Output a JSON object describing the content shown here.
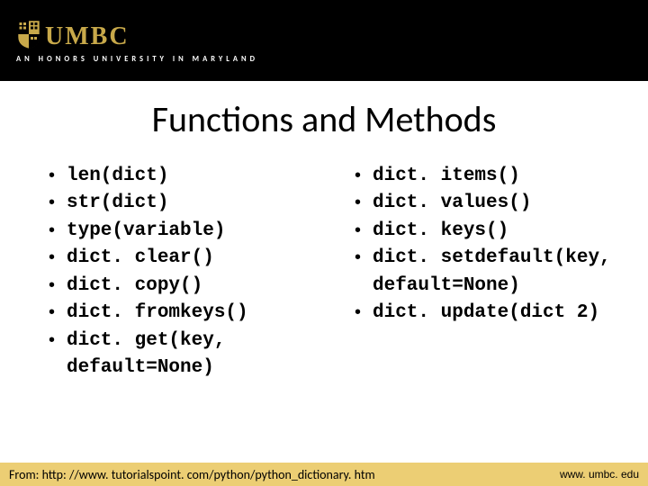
{
  "header": {
    "logo_text": "UMBC",
    "tagline": "AN HONORS UNIVERSITY IN MARYLAND"
  },
  "title": "Functions and Methods",
  "left_items": [
    "len(dict)",
    "str(dict)",
    "type(variable)",
    "dict. clear()",
    "dict. copy()",
    "dict. fromkeys()",
    "dict. get(key, default=None)"
  ],
  "right_items": [
    "dict. items()",
    "dict. values()",
    "dict. keys()",
    "dict. setdefault(key, default=None)",
    "dict. update(dict 2)"
  ],
  "footer": {
    "source": "From: http: //www. tutorialspoint. com/python/python_dictionary. htm",
    "site": "www. umbc. edu"
  }
}
